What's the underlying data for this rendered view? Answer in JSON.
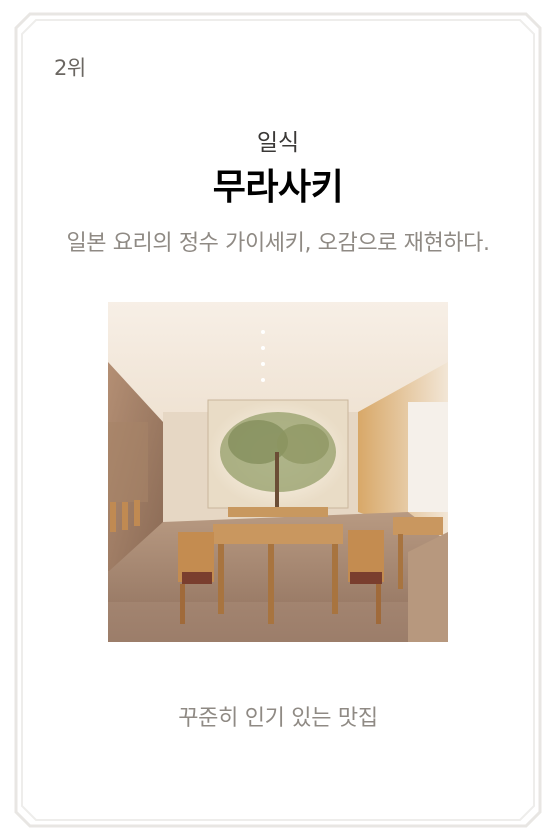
{
  "card": {
    "rank": "2위",
    "category": "일식",
    "name": "무라사키",
    "description": "일본 요리의 정수 가이세키, 오감으로 재현하다.",
    "photo_alt": "무라사키",
    "tagline": "꾸준히 인기 있는 맛집"
  },
  "colors": {
    "frame_outer": "#e8e6e3",
    "frame_inner": "#eeedeb",
    "muted_text": "#8f8a84",
    "title_text": "#000000"
  }
}
